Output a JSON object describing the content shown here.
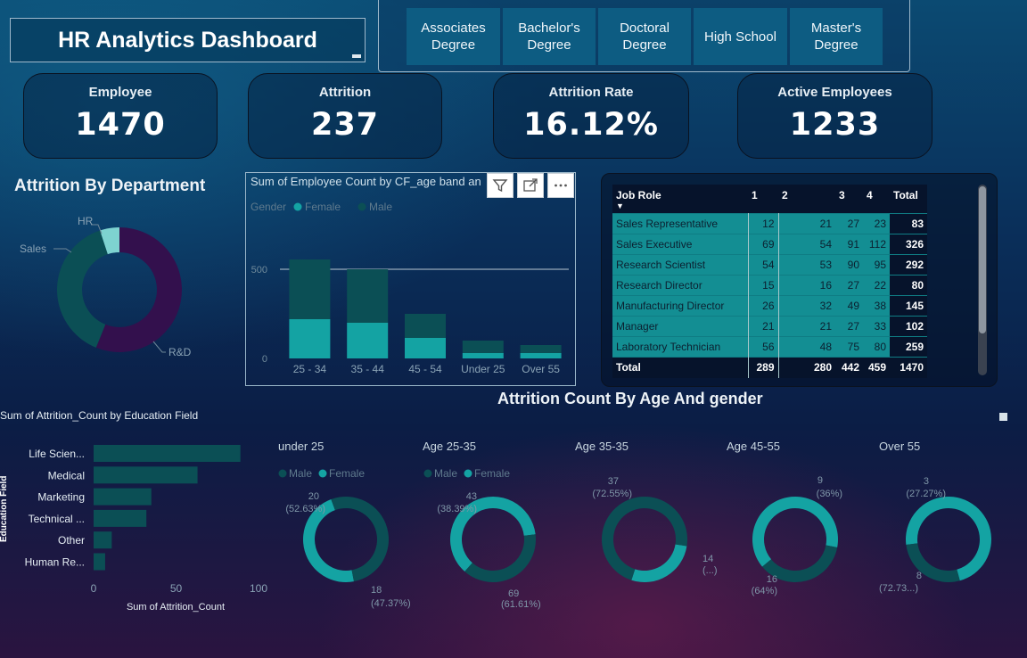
{
  "header": {
    "title": "HR Analytics Dashboard",
    "education_slicer": [
      "Associates Degree",
      "Bachelor's Degree",
      "Doctoral Degree",
      "High School",
      "Master's Degree"
    ]
  },
  "kpis": [
    {
      "label": "Employee",
      "value": "1470"
    },
    {
      "label": "Attrition",
      "value": "237"
    },
    {
      "label": "Attrition Rate",
      "value": "16.12%"
    },
    {
      "label": "Active Employees",
      "value": "1233"
    }
  ],
  "department_chart": {
    "title": "Attrition By Department",
    "labels": {
      "hr": "HR",
      "sales": "Sales",
      "rd": "R&D"
    }
  },
  "age_chart": {
    "title": "Sum of Employee Count by CF_age band an",
    "legend_title": "Gender",
    "legend": [
      "Female",
      "Male"
    ]
  },
  "job_table": {
    "headers": [
      "Job Role",
      "1",
      "2",
      "3",
      "4",
      "Total"
    ],
    "rows": [
      [
        "Sales Representative",
        "12",
        "21",
        "27",
        "23",
        "83"
      ],
      [
        "Sales Executive",
        "69",
        "54",
        "91",
        "112",
        "326"
      ],
      [
        "Research Scientist",
        "54",
        "53",
        "90",
        "95",
        "292"
      ],
      [
        "Research Director",
        "15",
        "16",
        "27",
        "22",
        "80"
      ],
      [
        "Manufacturing Director",
        "26",
        "32",
        "49",
        "38",
        "145"
      ],
      [
        "Manager",
        "21",
        "21",
        "27",
        "33",
        "102"
      ],
      [
        "Laboratory Technician",
        "56",
        "48",
        "75",
        "80",
        "259"
      ]
    ],
    "total": [
      "Total",
      "289",
      "280",
      "442",
      "459",
      "1470"
    ]
  },
  "education_chart": {
    "title": "Sum of Attrition_Count by Education Field",
    "ylabel": "Education Field",
    "xlabel": "Sum of Attrition_Count"
  },
  "gender_section": {
    "title": "Attrition Count By Age And gender",
    "legend": [
      "Male",
      "Female"
    ],
    "donuts": [
      {
        "title": "under 25",
        "a_value": "20",
        "a_pct": "(52.63%)",
        "b_value": "18",
        "b_pct": "(47.37%)"
      },
      {
        "title": "Age 25-35",
        "a_value": "43",
        "a_pct": "(38.39%)",
        "b_value": "69",
        "b_pct": "(61.61%)"
      },
      {
        "title": "Age 35-35",
        "a_value": "37",
        "a_pct": "(72.55%)",
        "b_value": "14",
        "b_pct": "(...)"
      },
      {
        "title": "Age 45-55",
        "a_value": "9",
        "a_pct": "(36%)",
        "b_value": "16",
        "b_pct": "(64%)"
      },
      {
        "title": "Over 55",
        "a_value": "3",
        "a_pct": "(27.27%)",
        "b_value": "8",
        "b_pct": "(72.73...)"
      }
    ]
  },
  "colors": {
    "teal": "#14a3a3",
    "dark_teal": "#0b4f55",
    "purple": "#33104d",
    "light_teal": "#7ed3d0"
  },
  "chart_data": [
    {
      "type": "pie",
      "title": "Attrition By Department",
      "categories": [
        "R&D",
        "Sales",
        "HR"
      ],
      "values": [
        133,
        92,
        12
      ]
    },
    {
      "type": "bar",
      "title": "Sum of Employee Count by CF_age band an",
      "categories": [
        "25 - 34",
        "35 - 44",
        "45 - 54",
        "Under 25",
        "Over 55"
      ],
      "series": [
        {
          "name": "Female",
          "values": [
            220,
            200,
            115,
            30,
            30
          ]
        },
        {
          "name": "Male",
          "values": [
            335,
            300,
            135,
            70,
            45
          ]
        }
      ],
      "yticks": [
        0,
        500
      ],
      "ylim": [
        0,
        600
      ]
    },
    {
      "type": "bar",
      "title": "Sum of Attrition_Count by Education Field",
      "categories": [
        "Life Scien...",
        "Medical",
        "Marketing",
        "Technical ...",
        "Other",
        "Human Re..."
      ],
      "values": [
        89,
        63,
        35,
        32,
        11,
        7
      ],
      "xticks": [
        0,
        50,
        100
      ],
      "xlim": [
        0,
        100
      ],
      "xlabel": "Sum of Attrition_Count",
      "ylabel": "Education Field"
    },
    {
      "type": "pie",
      "title": "Attrition Count By Age And gender",
      "panels": [
        {
          "title": "under 25",
          "values": [
            20,
            18
          ]
        },
        {
          "title": "Age 25-35",
          "values": [
            43,
            69
          ]
        },
        {
          "title": "Age 35-35",
          "values": [
            37,
            14
          ]
        },
        {
          "title": "Age 45-55",
          "values": [
            9,
            16
          ]
        },
        {
          "title": "Over 55",
          "values": [
            3,
            8
          ]
        }
      ]
    }
  ]
}
